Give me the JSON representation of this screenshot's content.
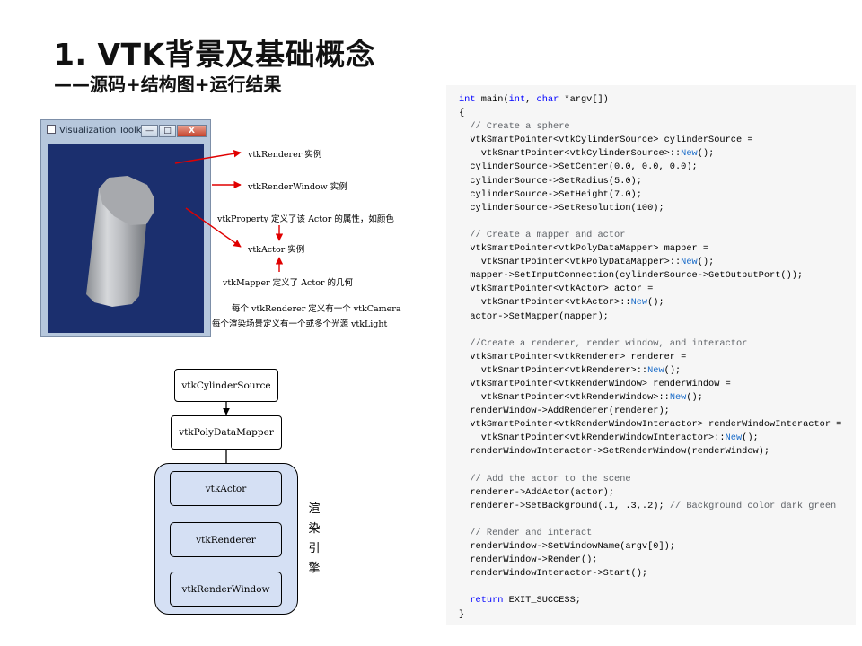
{
  "slide": {
    "title": "1. VTK背景及基础概念",
    "subtitle": "——源码+结构图+运行结果"
  },
  "vtk_window": {
    "title": "Visualization Toolkit ...",
    "minimize": "—",
    "maximize": "□",
    "close": "X",
    "background_color": "#1b2f6e"
  },
  "annotations": {
    "renderer": "vtkRenderer 实例",
    "render_window": "vtkRenderWindow 实例",
    "property": "vtkProperty 定义了该 Actor 的属性，如颜色",
    "actor": "vtkActor 实例",
    "mapper": "vtkMapper 定义了 Actor 的几何",
    "camera": "每个 vtkRenderer 定义有一个 vtkCamera",
    "light": "每个渲染场景定义有一个或多个光源 vtkLight"
  },
  "pipeline": {
    "source": "vtkCylinderSource",
    "mapper": "vtkPolyDataMapper",
    "actor": "vtkActor",
    "renderer": "vtkRenderer",
    "render_window": "vtkRenderWindow",
    "engine_label": [
      "渲",
      "染",
      "引",
      "擎"
    ]
  },
  "code_lines": [
    [
      [
        "kw",
        "int"
      ],
      [
        "t",
        " main("
      ],
      [
        "kw",
        "int"
      ],
      [
        "t",
        ", "
      ],
      [
        "kw",
        "char"
      ],
      [
        "t",
        " *argv[])"
      ]
    ],
    [
      [
        "t",
        "{"
      ]
    ],
    [
      [
        "cm",
        "  // Create a sphere"
      ]
    ],
    [
      [
        "t",
        "  vtkSmartPointer<vtkCylinderSource> cylinderSource ="
      ]
    ],
    [
      [
        "t",
        "    vtkSmartPointer<vtkCylinderSource>::"
      ],
      [
        "nm",
        "New"
      ],
      [
        "t",
        "();"
      ]
    ],
    [
      [
        "t",
        "  cylinderSource->SetCenter(0.0, 0.0, 0.0);"
      ]
    ],
    [
      [
        "t",
        "  cylinderSource->SetRadius(5.0);"
      ]
    ],
    [
      [
        "t",
        "  cylinderSource->SetHeight(7.0);"
      ]
    ],
    [
      [
        "t",
        "  cylinderSource->SetResolution(100);"
      ]
    ],
    [
      [
        "t",
        ""
      ]
    ],
    [
      [
        "cm",
        "  // Create a mapper and actor"
      ]
    ],
    [
      [
        "t",
        "  vtkSmartPointer<vtkPolyDataMapper> mapper ="
      ]
    ],
    [
      [
        "t",
        "    vtkSmartPointer<vtkPolyDataMapper>::"
      ],
      [
        "nm",
        "New"
      ],
      [
        "t",
        "();"
      ]
    ],
    [
      [
        "t",
        "  mapper->SetInputConnection(cylinderSource->GetOutputPort());"
      ]
    ],
    [
      [
        "t",
        "  vtkSmartPointer<vtkActor> actor ="
      ]
    ],
    [
      [
        "t",
        "    vtkSmartPointer<vtkActor>::"
      ],
      [
        "nm",
        "New"
      ],
      [
        "t",
        "();"
      ]
    ],
    [
      [
        "t",
        "  actor->SetMapper(mapper);"
      ]
    ],
    [
      [
        "t",
        ""
      ]
    ],
    [
      [
        "cm",
        "  //Create a renderer, render window, and interactor"
      ]
    ],
    [
      [
        "t",
        "  vtkSmartPointer<vtkRenderer> renderer ="
      ]
    ],
    [
      [
        "t",
        "    vtkSmartPointer<vtkRenderer>::"
      ],
      [
        "nm",
        "New"
      ],
      [
        "t",
        "();"
      ]
    ],
    [
      [
        "t",
        "  vtkSmartPointer<vtkRenderWindow> renderWindow ="
      ]
    ],
    [
      [
        "t",
        "    vtkSmartPointer<vtkRenderWindow>::"
      ],
      [
        "nm",
        "New"
      ],
      [
        "t",
        "();"
      ]
    ],
    [
      [
        "t",
        "  renderWindow->AddRenderer(renderer);"
      ]
    ],
    [
      [
        "t",
        "  vtkSmartPointer<vtkRenderWindowInteractor> renderWindowInteractor ="
      ]
    ],
    [
      [
        "t",
        "    vtkSmartPointer<vtkRenderWindowInteractor>::"
      ],
      [
        "nm",
        "New"
      ],
      [
        "t",
        "();"
      ]
    ],
    [
      [
        "t",
        "  renderWindowInteractor->SetRenderWindow(renderWindow);"
      ]
    ],
    [
      [
        "t",
        ""
      ]
    ],
    [
      [
        "cm",
        "  // Add the actor to the scene"
      ]
    ],
    [
      [
        "t",
        "  renderer->AddActor(actor);"
      ]
    ],
    [
      [
        "t",
        "  renderer->SetBackground(.1, .3,.2); "
      ],
      [
        "cm",
        "// Background color dark green"
      ]
    ],
    [
      [
        "t",
        ""
      ]
    ],
    [
      [
        "cm",
        "  // Render and interact"
      ]
    ],
    [
      [
        "t",
        "  renderWindow->SetWindowName(argv[0]);"
      ]
    ],
    [
      [
        "t",
        "  renderWindow->Render();"
      ]
    ],
    [
      [
        "t",
        "  renderWindowInteractor->Start();"
      ]
    ],
    [
      [
        "t",
        ""
      ]
    ],
    [
      [
        "t",
        "  "
      ],
      [
        "kw",
        "return"
      ],
      [
        "t",
        " EXIT_SUCCESS;"
      ]
    ],
    [
      [
        "t",
        "}"
      ]
    ]
  ],
  "colors": {
    "arrow_red": "#e00000",
    "engine_fill": "#d5e0f4",
    "code_background": "#f6f6f6",
    "keyword": "#0000ff",
    "comment": "#5f6368"
  }
}
